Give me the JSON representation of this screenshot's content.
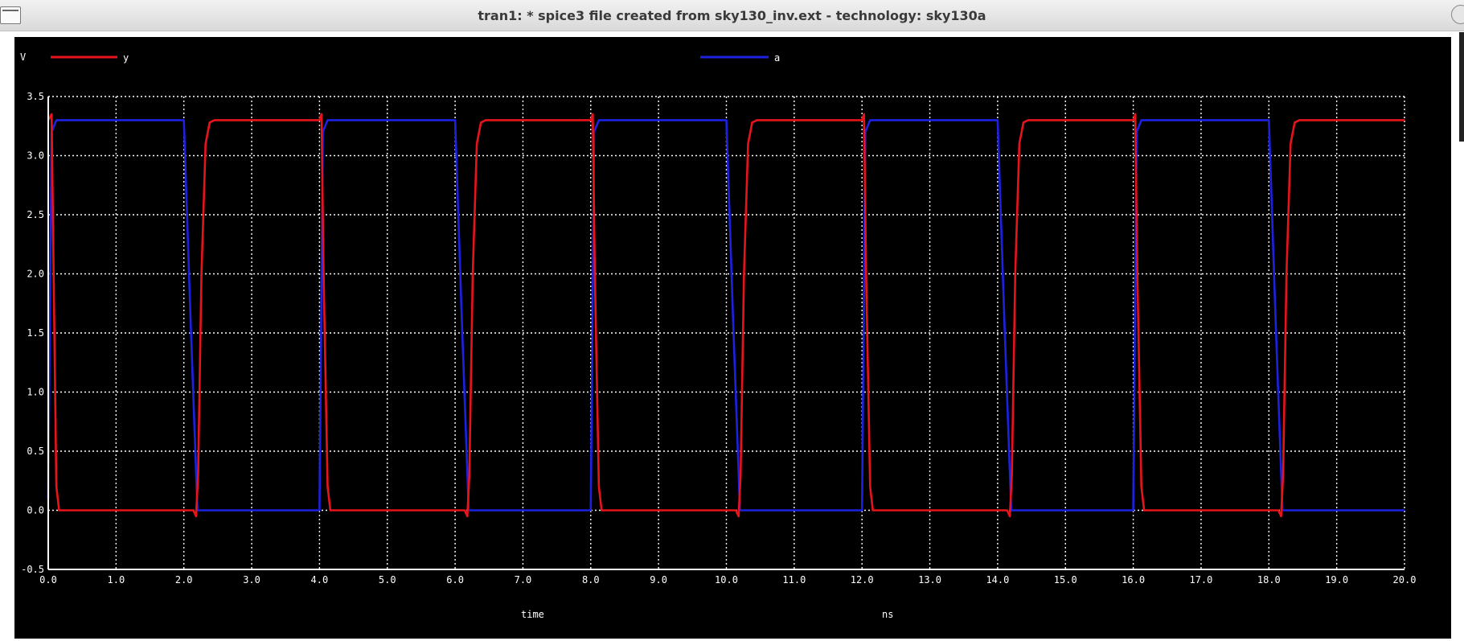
{
  "window": {
    "title": "tran1: * spice3 file created from sky130_inv.ext - technology: sky130a"
  },
  "colors": {
    "background": "#000000",
    "grid": "#ffffff",
    "axis_text": "#ffffff",
    "y": "#e8141c",
    "a": "#1c22e0"
  },
  "chart_data": {
    "type": "line",
    "ylabel": "V",
    "xlabel": "time",
    "xunit": "ns",
    "xlim": [
      0.0,
      20.0
    ],
    "ylim": [
      -0.5,
      3.5
    ],
    "grid": true,
    "legend_placement": "top",
    "xticks": [
      "0.0",
      "1.0",
      "2.0",
      "3.0",
      "4.0",
      "5.0",
      "6.0",
      "7.0",
      "8.0",
      "9.0",
      "10.0",
      "11.0",
      "12.0",
      "13.0",
      "14.0",
      "15.0",
      "16.0",
      "17.0",
      "18.0",
      "19.0",
      "20.0"
    ],
    "yticks": [
      "-0.5",
      "0.0",
      "0.5",
      "1.0",
      "1.5",
      "2.0",
      "2.5",
      "3.0",
      "3.5"
    ],
    "series": [
      {
        "name": "y",
        "x": [
          0.0,
          0.05,
          0.08,
          0.12,
          0.16,
          0.2,
          2.14,
          2.18,
          2.21,
          2.26,
          2.32,
          2.38,
          2.45,
          4.0,
          4.03,
          4.06,
          4.12,
          4.16,
          4.2,
          6.14,
          6.18,
          6.21,
          6.26,
          6.32,
          6.38,
          6.45,
          8.0,
          8.03,
          8.06,
          8.12,
          8.16,
          8.2,
          10.14,
          10.18,
          10.21,
          10.26,
          10.32,
          10.38,
          10.45,
          12.0,
          12.03,
          12.06,
          12.12,
          12.16,
          12.2,
          14.14,
          14.18,
          14.21,
          14.26,
          14.32,
          14.38,
          14.45,
          16.0,
          16.03,
          16.06,
          16.12,
          16.16,
          16.2,
          18.14,
          18.18,
          18.21,
          18.26,
          18.32,
          18.38,
          18.45,
          20.0
        ],
        "y": [
          3.3,
          3.35,
          2.0,
          0.2,
          0.0,
          0.0,
          0.0,
          -0.05,
          0.3,
          2.0,
          3.1,
          3.28,
          3.3,
          3.3,
          3.35,
          2.0,
          0.2,
          0.0,
          0.0,
          0.0,
          -0.05,
          0.3,
          2.0,
          3.1,
          3.28,
          3.3,
          3.3,
          3.35,
          2.0,
          0.2,
          0.0,
          0.0,
          0.0,
          -0.05,
          0.3,
          2.0,
          3.1,
          3.28,
          3.3,
          3.3,
          3.35,
          2.0,
          0.2,
          0.0,
          0.0,
          0.0,
          -0.05,
          0.3,
          2.0,
          3.1,
          3.28,
          3.3,
          3.3,
          3.35,
          2.0,
          0.2,
          0.0,
          0.0,
          0.0,
          -0.05,
          0.3,
          2.0,
          3.1,
          3.28,
          3.3,
          3.3
        ]
      },
      {
        "name": "a",
        "x": [
          0.0,
          0.05,
          0.12,
          2.0,
          2.1,
          2.2,
          4.0,
          4.05,
          4.12,
          6.0,
          6.1,
          6.2,
          8.0,
          8.05,
          8.12,
          10.0,
          10.1,
          10.2,
          12.0,
          12.05,
          12.12,
          14.0,
          14.1,
          14.2,
          16.0,
          16.05,
          16.12,
          18.0,
          18.1,
          18.2,
          20.0
        ],
        "y": [
          0.1,
          3.2,
          3.3,
          3.3,
          1.6,
          0.0,
          0.0,
          3.2,
          3.3,
          3.3,
          1.6,
          0.0,
          0.0,
          3.2,
          3.3,
          3.3,
          1.6,
          0.0,
          0.0,
          3.2,
          3.3,
          3.3,
          1.6,
          0.0,
          0.0,
          3.2,
          3.3,
          3.3,
          1.6,
          0.0,
          0.0
        ]
      }
    ]
  }
}
